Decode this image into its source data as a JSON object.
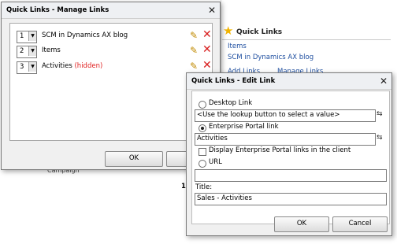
{
  "background": {
    "quick_links_title": "Quick Links",
    "links": [
      "Items",
      "SCM in Dynamics AX blog"
    ],
    "add_links": "Add Links",
    "manage_links": "Manage Links",
    "text_fragment": "Campaign",
    "number": "1"
  },
  "manage_dialog": {
    "title": "Quick Links - Manage Links",
    "rows": [
      {
        "position": "1",
        "label": "SCM in Dynamics AX blog",
        "hidden": ""
      },
      {
        "position": "2",
        "label": "Items",
        "hidden": ""
      },
      {
        "position": "3",
        "label": "Activities",
        "hidden": "(hidden)"
      }
    ],
    "ok_label": "OK",
    "cancel_label": "Ca"
  },
  "edit_dialog": {
    "title": "Quick Links - Edit Link",
    "desktop_link_label": "Desktop Link",
    "desktop_link_value": "<Use the lookup button to select a value>",
    "ep_link_label": "Enterprise Portal link",
    "ep_link_value": "Activities",
    "display_ep_label": "Display Enterprise Portal links in the client",
    "url_label": "URL",
    "url_value": "",
    "title_label": "Title:",
    "title_value": "Sales - Activities",
    "ok_label": "OK",
    "cancel_label": "Cancel",
    "selected_type": "ep_link"
  },
  "colors": {
    "link": "#1f4fa0",
    "hidden": "#e02020",
    "delete": "#d81e1e"
  }
}
